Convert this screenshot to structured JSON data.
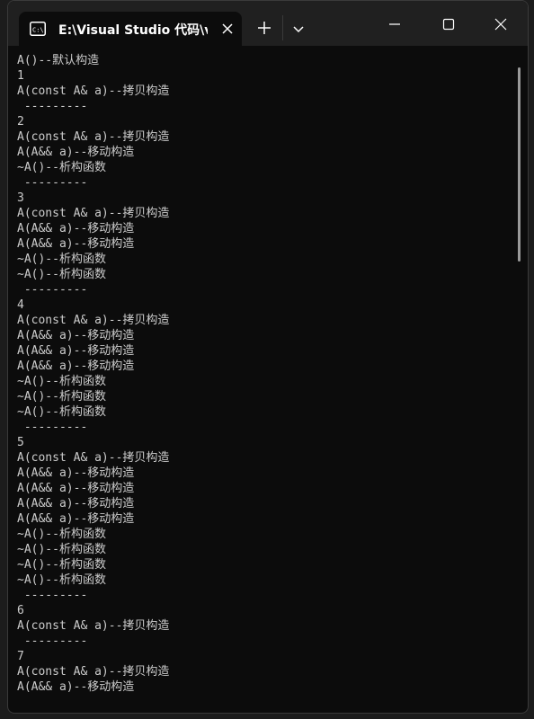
{
  "titlebar": {
    "tab_title": "E:\\Visual Studio 代码\\v",
    "tab_icon": "terminal-icon",
    "close_icon": "close-icon",
    "new_tab_icon": "plus-icon",
    "dropdown_icon": "chevron-down-icon",
    "minimize_icon": "minimize-icon",
    "maximize_icon": "maximize-icon",
    "window_close_icon": "close-icon"
  },
  "colors": {
    "console_bg": "#0c0c0c",
    "text": "#cccccc",
    "titlebar_bg": "#202020"
  },
  "console": {
    "lines": [
      "A()--默认构造",
      "1",
      "A(const A& a)--拷贝构造",
      " ---------",
      "2",
      "A(const A& a)--拷贝构造",
      "A(A&& a)--移动构造",
      "~A()--析构函数",
      " ---------",
      "3",
      "A(const A& a)--拷贝构造",
      "A(A&& a)--移动构造",
      "A(A&& a)--移动构造",
      "~A()--析构函数",
      "~A()--析构函数",
      " ---------",
      "4",
      "A(const A& a)--拷贝构造",
      "A(A&& a)--移动构造",
      "A(A&& a)--移动构造",
      "A(A&& a)--移动构造",
      "~A()--析构函数",
      "~A()--析构函数",
      "~A()--析构函数",
      " ---------",
      "5",
      "A(const A& a)--拷贝构造",
      "A(A&& a)--移动构造",
      "A(A&& a)--移动构造",
      "A(A&& a)--移动构造",
      "A(A&& a)--移动构造",
      "~A()--析构函数",
      "~A()--析构函数",
      "~A()--析构函数",
      "~A()--析构函数",
      " ---------",
      "6",
      "A(const A& a)--拷贝构造",
      " ---------",
      "7",
      "A(const A& a)--拷贝构造",
      "A(A&& a)--移动构造"
    ]
  }
}
